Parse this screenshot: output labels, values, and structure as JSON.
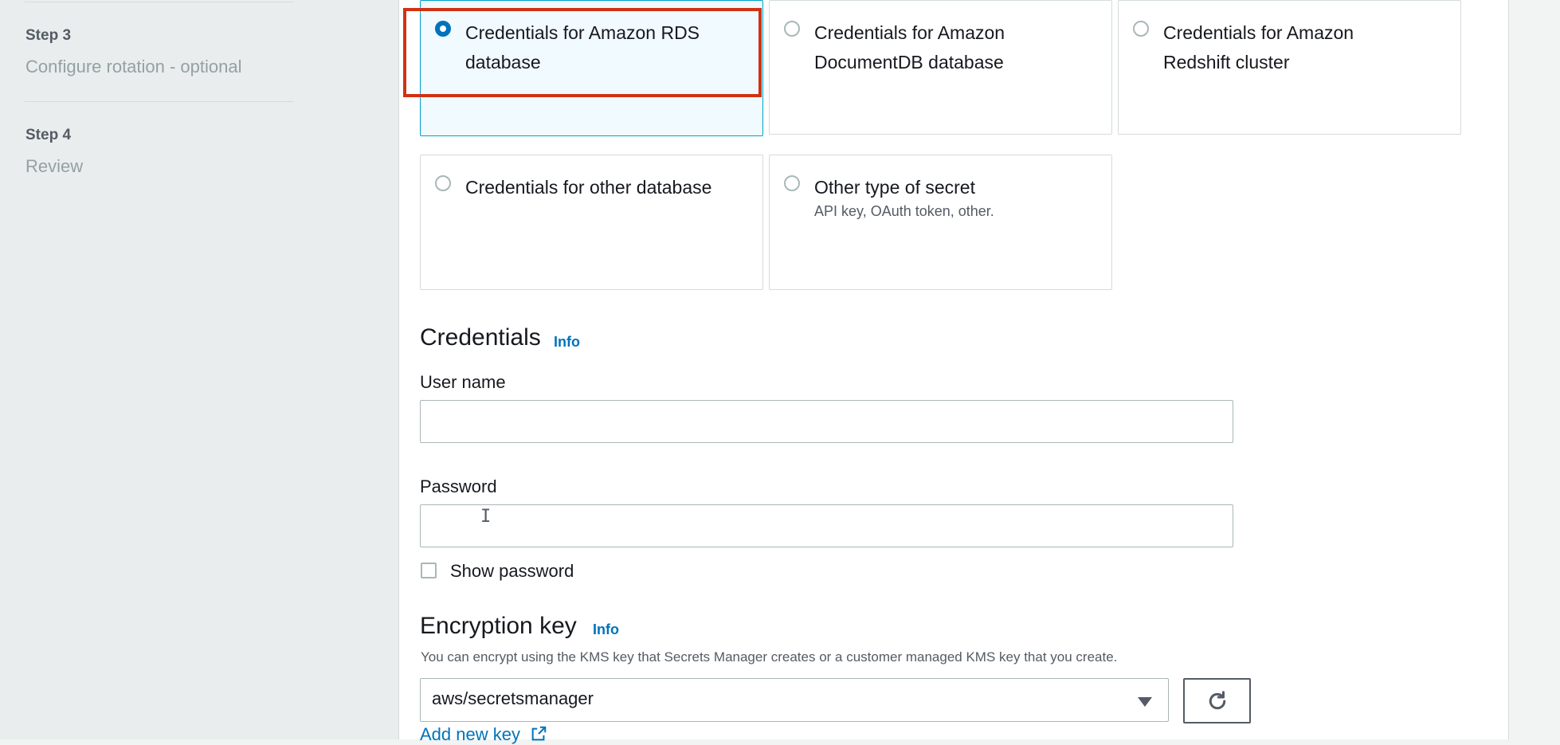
{
  "steps": [
    {
      "num": "Step 3",
      "name": "Configure rotation - optional"
    },
    {
      "num": "Step 4",
      "name": "Review"
    }
  ],
  "secret_types": [
    {
      "label_line1": "Credentials for Amazon RDS",
      "label_line2": "database",
      "selected": true
    },
    {
      "label_line1": "Credentials for Amazon",
      "label_line2": "DocumentDB database",
      "selected": false
    },
    {
      "label_line1": "Credentials for Amazon",
      "label_line2": "Redshift cluster",
      "selected": false
    },
    {
      "label_line1": "Credentials for other database",
      "label_line2": "",
      "selected": false
    },
    {
      "label_line1": "Other type of secret",
      "description": "API key, OAuth token, other.",
      "selected": false
    }
  ],
  "credentials": {
    "title": "Credentials",
    "info": "Info",
    "username_label": "User name",
    "username_value": "",
    "password_label": "Password",
    "password_value": "",
    "show_password_label": "Show password"
  },
  "encryption": {
    "title": "Encryption key",
    "info": "Info",
    "description": "You can encrypt using the KMS key that Secrets Manager creates or a customer managed KMS key that you create.",
    "selected_key": "aws/secretsmanager",
    "add_new_key": "Add new key"
  },
  "colors": {
    "accent": "#0073bb",
    "highlight": "#d13212",
    "selected_tile_bg": "#f1faff"
  },
  "icons": {
    "refresh": "refresh-icon",
    "external_link": "external-link-icon",
    "dropdown": "caret-down-icon"
  }
}
